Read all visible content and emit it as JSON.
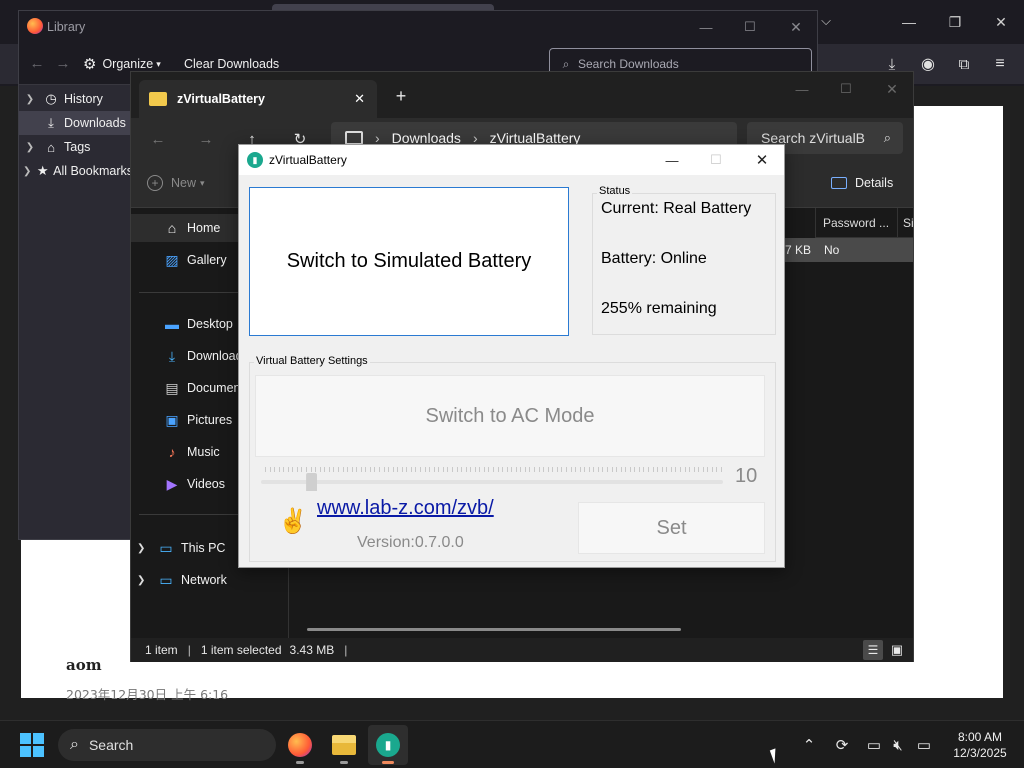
{
  "library": {
    "title": "Library",
    "organize_label": "Organize",
    "clear_downloads_label": "Clear Downloads",
    "search_placeholder": "Search Downloads",
    "items": [
      {
        "label": "History"
      },
      {
        "label": "Downloads"
      },
      {
        "label": "Tags"
      },
      {
        "label": "All Bookmarks"
      }
    ]
  },
  "browser": {
    "page": {
      "author": "aom",
      "date": "2023年12月30日 上午 6:16"
    }
  },
  "explorer": {
    "tab_title": "zVirtualBattery",
    "breadcrumb": [
      "Downloads",
      "zVirtualBattery"
    ],
    "search_placeholder": "Search zVirtualB",
    "new_label": "New",
    "details_label": "Details",
    "columns": [
      "Password ...",
      "Si"
    ],
    "row": {
      "size": "3,507 KB",
      "password": "No"
    },
    "nav": {
      "home": "Home",
      "gallery": "Gallery",
      "desktop": "Desktop",
      "downloads": "Downloads",
      "documents": "Documents",
      "pictures": "Pictures",
      "music": "Music",
      "videos": "Videos",
      "this_pc": "This PC",
      "network": "Network"
    },
    "status": {
      "items": "1 item",
      "selected": "1 item selected",
      "size": "3.43 MB"
    }
  },
  "zvb": {
    "title": "zVirtualBattery",
    "switch_button": "Switch to Simulated Battery",
    "status_legend": "Status",
    "status_current": "Current: Real Battery",
    "status_battery": "Battery: Online",
    "status_remaining": "255% remaining",
    "settings_legend": "Virtual Battery Settings",
    "ac_button": "Switch to AC Mode",
    "slider_value": "10",
    "slider_fraction": 0.1,
    "link": "www.lab-z.com/zvb/",
    "version": "Version:0.7.0.0",
    "set_button": "Set"
  },
  "taskbar": {
    "search_label": "Search",
    "time": "8:00 AM",
    "date": "12/3/2025"
  },
  "colors": {
    "accent": "#2a7ad2",
    "link": "#0a1aa6",
    "disabled_text": "#8a8a8a"
  }
}
